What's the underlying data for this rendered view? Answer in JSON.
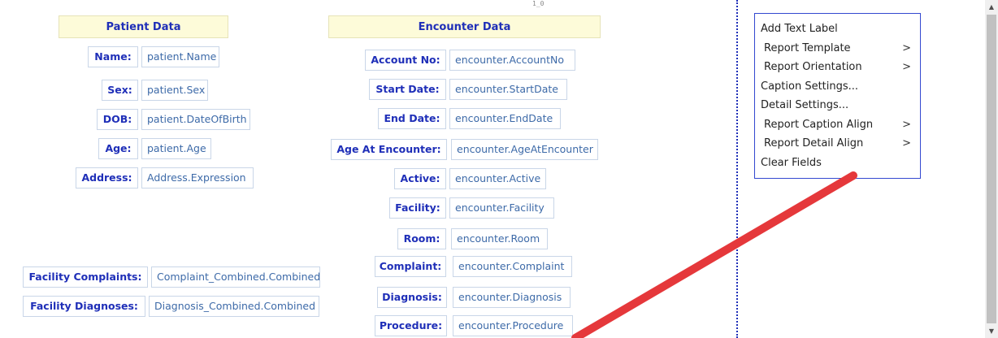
{
  "top_mark": "1̲0",
  "patient": {
    "header": "Patient Data",
    "fields": [
      {
        "label": "Name:",
        "value": "patient.Name"
      },
      {
        "label": "Sex:",
        "value": "patient.Sex"
      },
      {
        "label": "DOB:",
        "value": "patient.DateOfBirth"
      },
      {
        "label": "Age:",
        "value": "patient.Age"
      },
      {
        "label": "Address:",
        "value": "Address.Expression"
      }
    ],
    "extra_fields": [
      {
        "label": "Facility Complaints:",
        "value": "Complaint_Combined.Combined"
      },
      {
        "label": "Facility Diagnoses:",
        "value": "Diagnosis_Combined.Combined"
      }
    ]
  },
  "encounter": {
    "header": "Encounter Data",
    "fields": [
      {
        "label": "Account No:",
        "value": "encounter.AccountNo"
      },
      {
        "label": "Start Date:",
        "value": "encounter.StartDate"
      },
      {
        "label": "End Date:",
        "value": "encounter.EndDate"
      },
      {
        "label": "Age At Encounter:",
        "value": "encounter.AgeAtEncounter"
      },
      {
        "label": "Active:",
        "value": "encounter.Active"
      },
      {
        "label": "Facility:",
        "value": "encounter.Facility"
      },
      {
        "label": "Room:",
        "value": "encounter.Room"
      },
      {
        "label": "Complaint:",
        "value": "encounter.Complaint"
      },
      {
        "label": "Diagnosis:",
        "value": "encounter.Diagnosis"
      },
      {
        "label": "Procedure:",
        "value": "encounter.Procedure"
      }
    ]
  },
  "context_menu": {
    "items": [
      {
        "label": "Add Text Label",
        "submenu": ""
      },
      {
        "label": "Report Template",
        "submenu": ">"
      },
      {
        "label": "Report Orientation",
        "submenu": ">"
      },
      {
        "label": "Caption Settings...",
        "submenu": ""
      },
      {
        "label": "Detail Settings...",
        "submenu": ""
      },
      {
        "label": "Report Caption Align",
        "submenu": ">"
      },
      {
        "label": "Report Detail Align",
        "submenu": ">"
      },
      {
        "label": "Clear Fields",
        "submenu": ""
      }
    ]
  },
  "annotation": {
    "arrow_color": "#e5383b"
  },
  "colors": {
    "label_text": "#1f2fb8",
    "value_text": "#3d6aa8",
    "header_bg": "#fdfbd9",
    "divider": "#1f2fb8",
    "menu_border": "#3348d0"
  }
}
